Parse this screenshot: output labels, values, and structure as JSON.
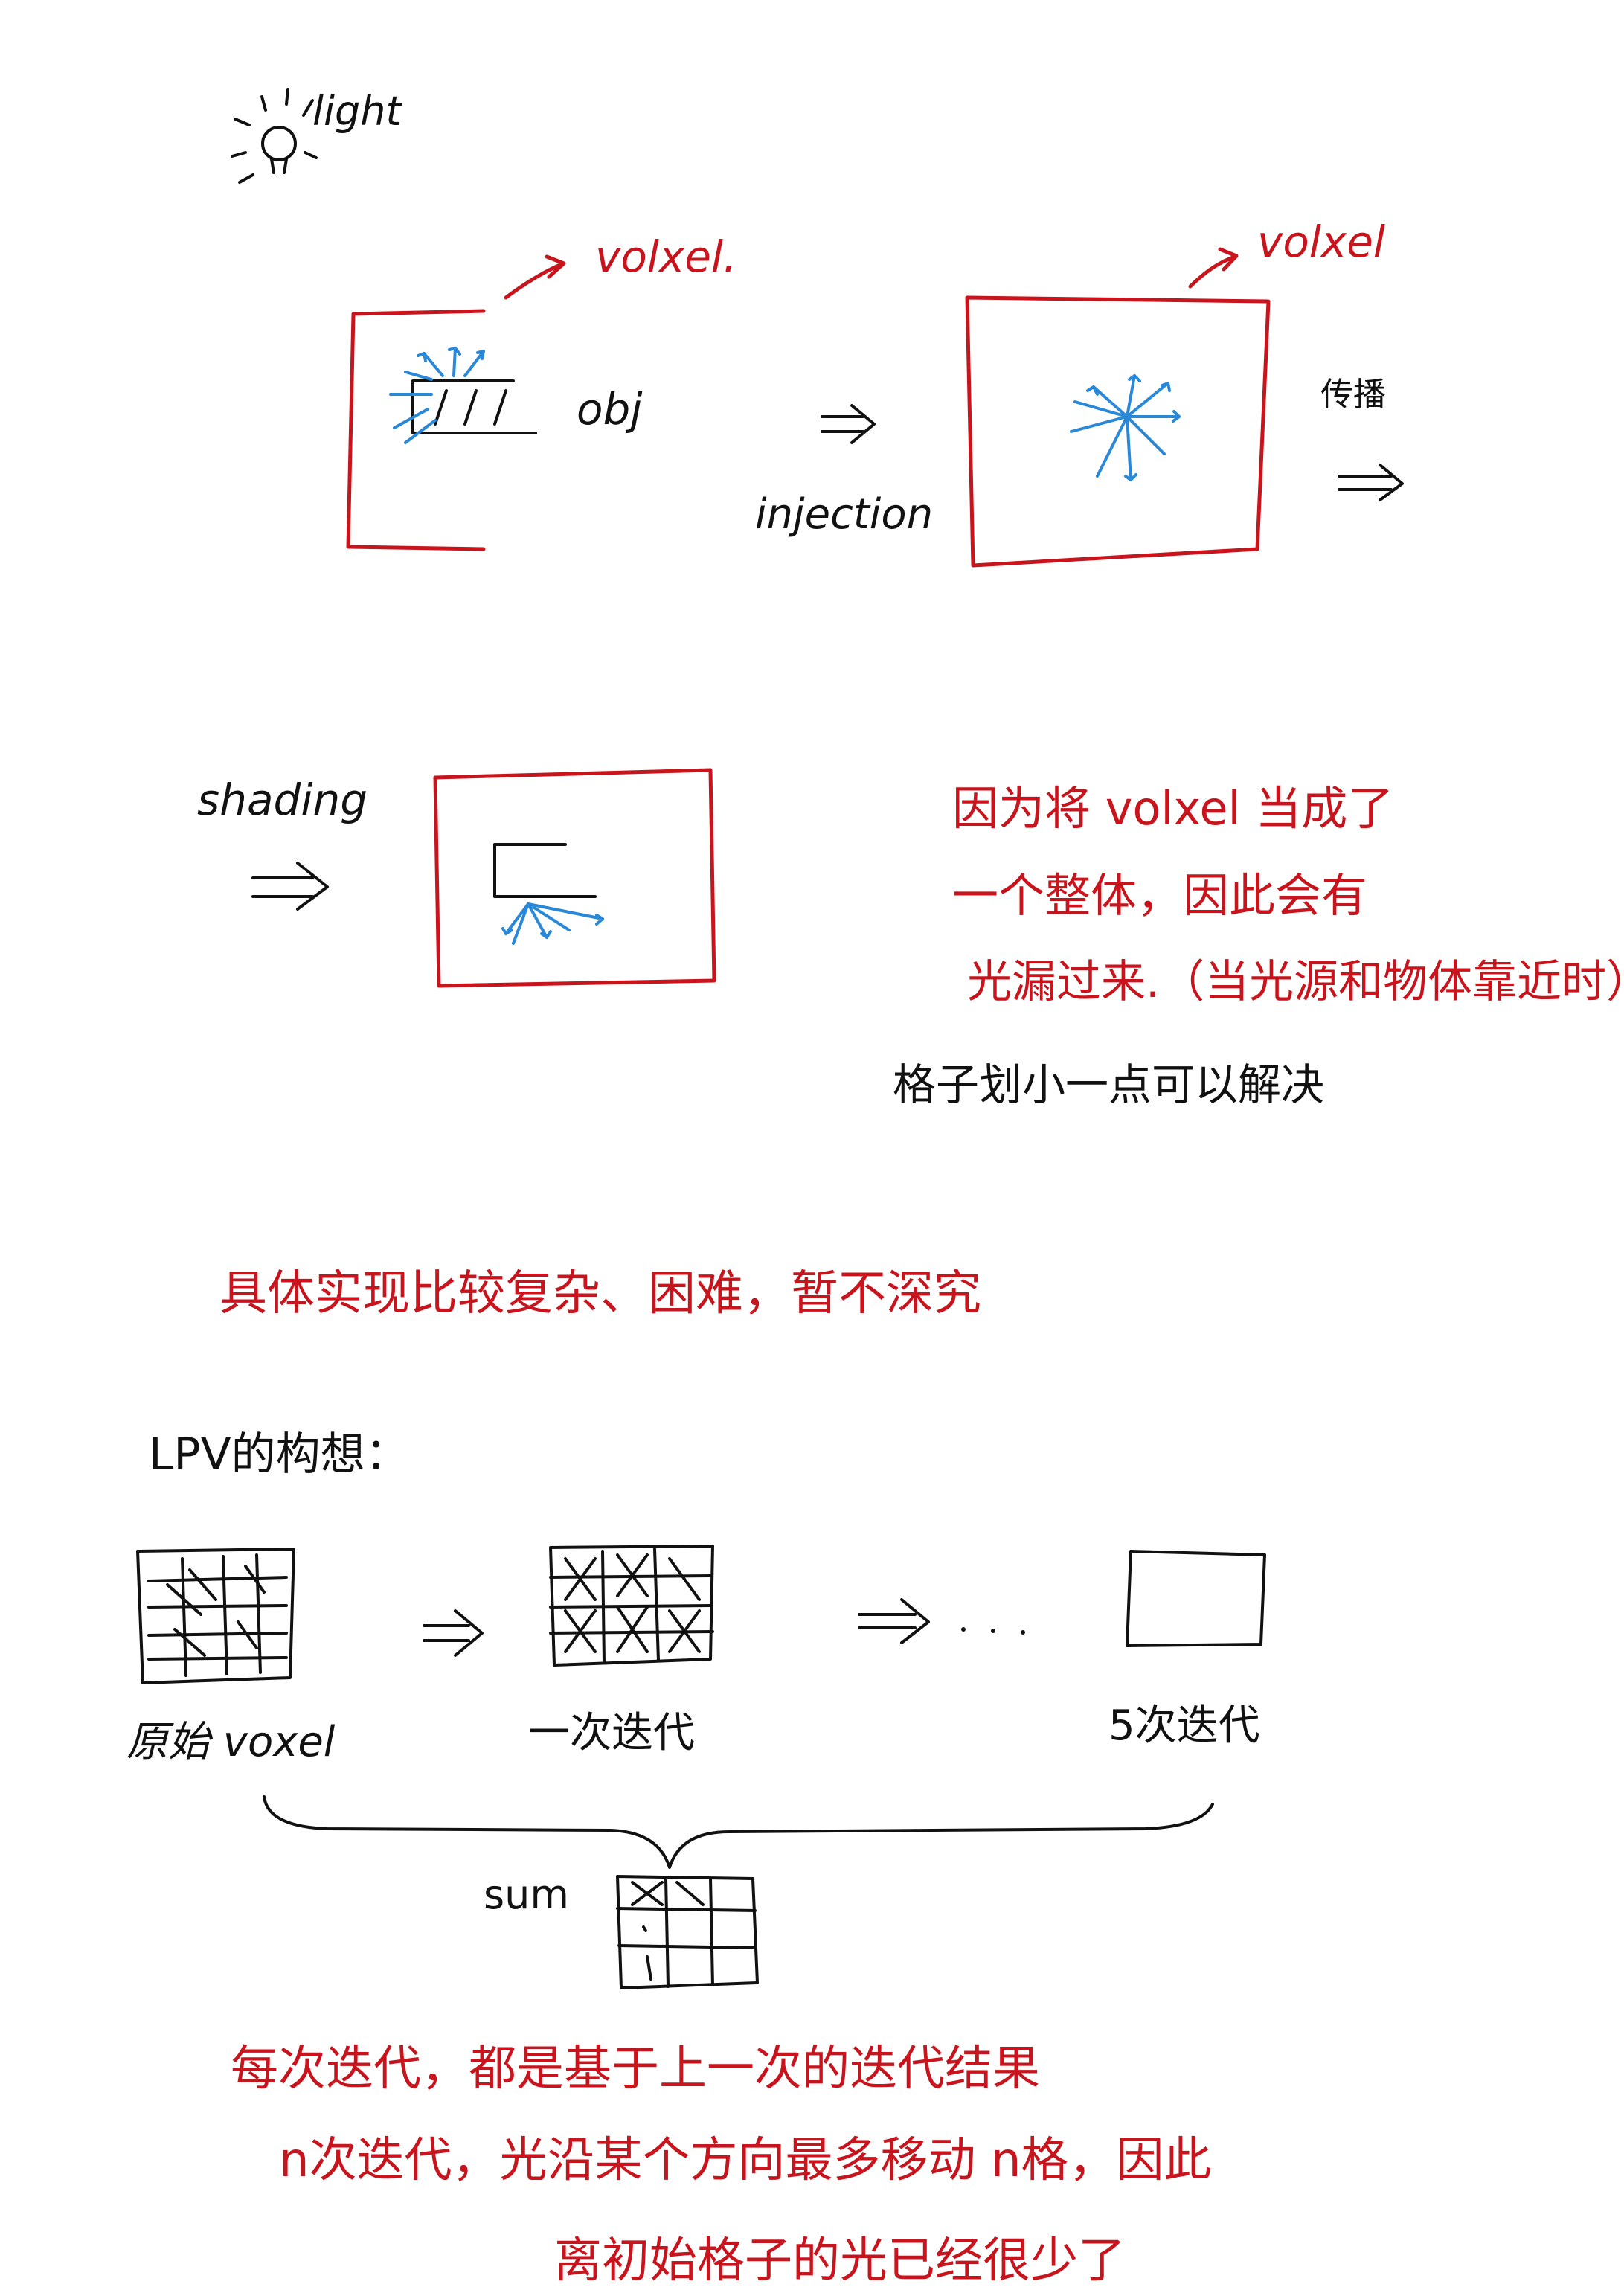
{
  "colors": {
    "ink": "#111111",
    "red": "#c8141c",
    "blue": "#2a88d8"
  },
  "labels": {
    "light": "light",
    "volxel_1": "volxel.",
    "volxel_2": "volxel",
    "obj": "obj",
    "injection": "injection",
    "propagate": "传播",
    "shading": "shading"
  },
  "notes": {
    "leak_1": "因为将 volxel 当成了",
    "leak_2": "一个整体，因此会有",
    "leak_3": "光漏过来.（当光源和物体靠近时）",
    "fix": "格子划小一点可以解决",
    "complex": "具体实现比较复杂、困难，暂不深究"
  },
  "lpv": {
    "title": "LPV的构想：",
    "grid_1": "原始 voxel",
    "grid_2": "一次迭代",
    "grid_3": "5次迭代",
    "sum": "sum"
  },
  "bottom": {
    "line_1": "每次迭代，都是基于上一次的迭代结果",
    "line_2": "n次迭代，光沿某个方向最多移动 n格，因此",
    "line_3": "离初始格子的光已经很少了"
  }
}
